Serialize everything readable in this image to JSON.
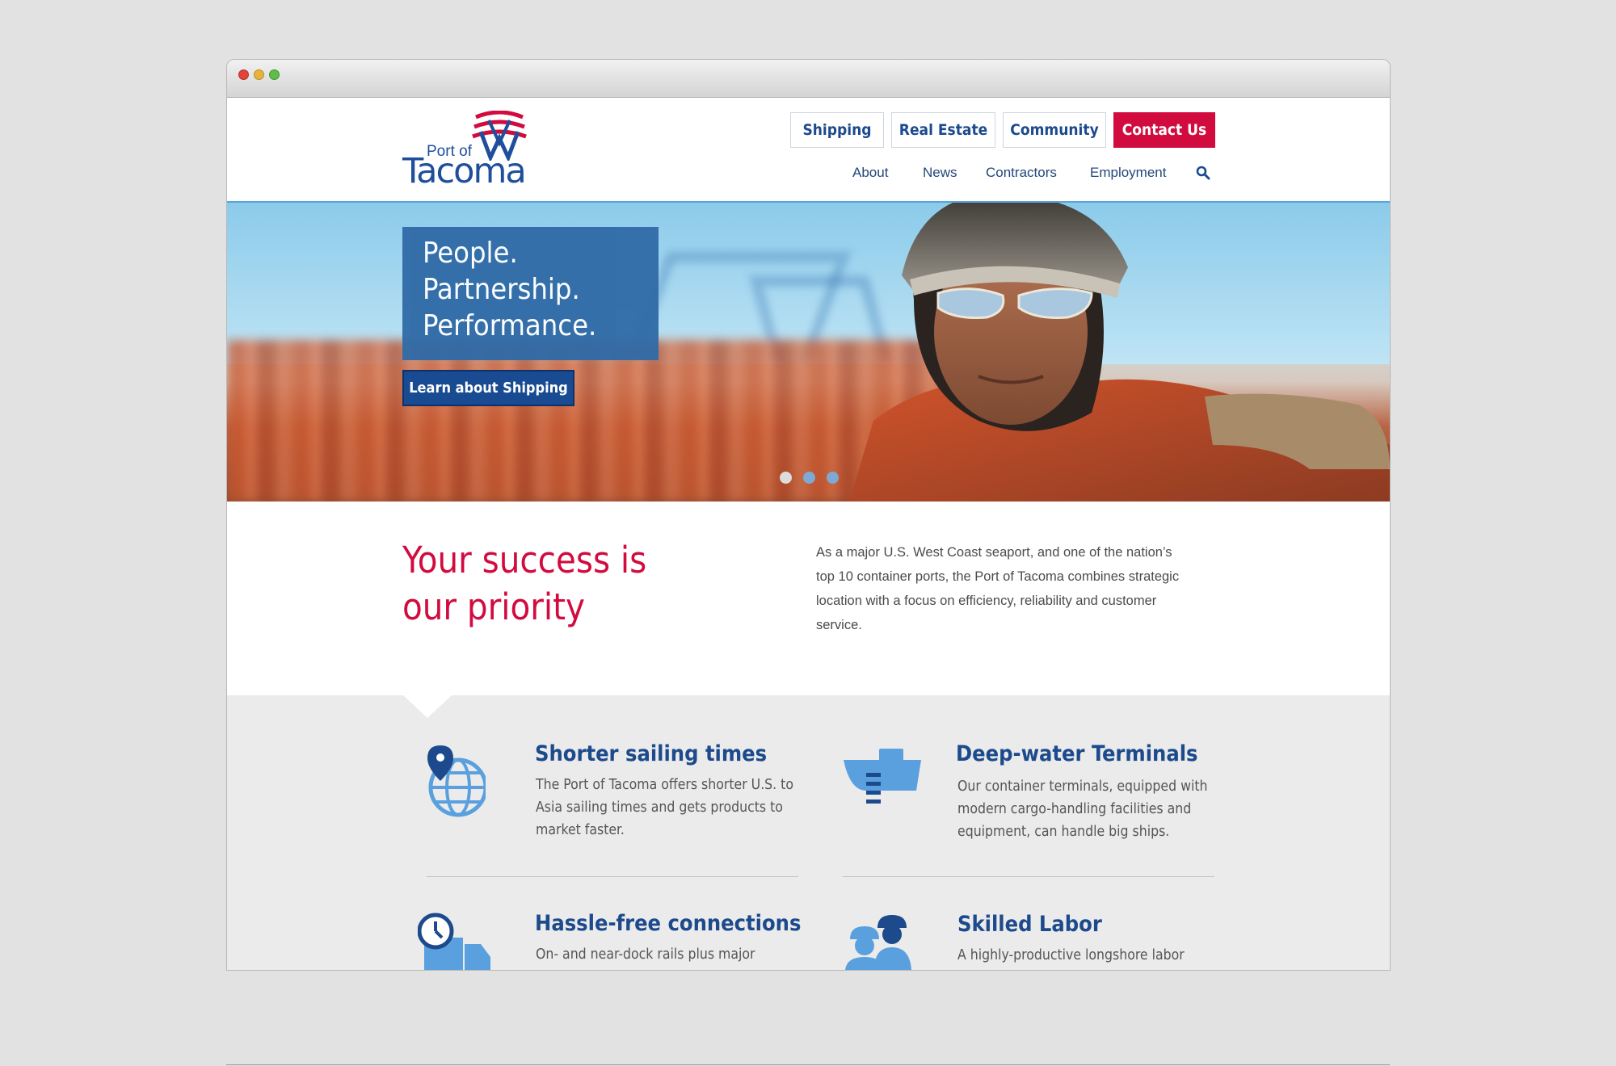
{
  "logo": {
    "line1": "Port of",
    "line2": "Tacoma"
  },
  "primary_nav": [
    "Shipping",
    "Real Estate",
    "Community",
    "Contact Us"
  ],
  "secondary_nav": [
    "About",
    "News",
    "Contractors",
    "Employment"
  ],
  "hero": {
    "tagline": [
      "People.",
      "Partnership.",
      "Performance."
    ],
    "cta": "Learn about Shipping",
    "slides": 3,
    "active_slide": 1
  },
  "intro": {
    "heading_line1": "Your success is",
    "heading_line2": "our priority",
    "text": "As a major U.S. West Coast seaport, and one of the nation’s top 10 container ports, the Port of Tacoma combines strategic location with a focus on efficiency, reliability and customer service."
  },
  "features": [
    {
      "title": "Shorter sailing times",
      "text": "The Port of Tacoma offers shorter U.S. to Asia sailing times and gets products to market faster.",
      "icon": "globe-pin-icon"
    },
    {
      "title": "Deep-water Terminals",
      "text": "Our container terminals, equipped with modern cargo-handling facilities and equipment, can handle big ships.",
      "icon": "ship-icon"
    },
    {
      "title": "Hassle-free connections",
      "text": "On- and near-dock rails plus major",
      "icon": "truck-clock-icon"
    },
    {
      "title": "Skilled Labor",
      "text": "A highly-productive longshore labor",
      "icon": "workers-icon"
    }
  ],
  "colors": {
    "brand_blue": "#1c4a8c",
    "brand_red": "#d20b3f",
    "accent_blue": "#5aa3dc"
  }
}
